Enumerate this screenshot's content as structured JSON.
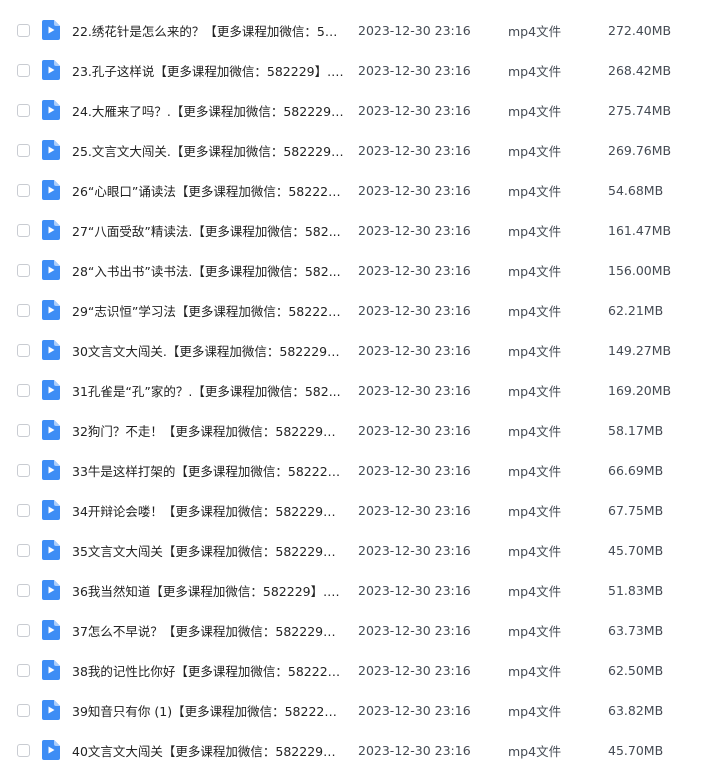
{
  "file_list": {
    "rows": [
      {
        "name": "22.绣花针是怎么来的？【更多课程加微信：582...",
        "date": "2023-12-30 23:16",
        "type": "mp4文件",
        "size": "272.40MB",
        "icon": "video-file-icon"
      },
      {
        "name": "23.孔子这样说【更多课程加微信：582229】.mp4",
        "date": "2023-12-30 23:16",
        "type": "mp4文件",
        "size": "268.42MB",
        "icon": "video-file-icon"
      },
      {
        "name": "24.大雁来了吗？.【更多课程加微信：582229】....",
        "date": "2023-12-30 23:16",
        "type": "mp4文件",
        "size": "275.74MB",
        "icon": "video-file-icon"
      },
      {
        "name": "25.文言文大闯关.【更多课程加微信：582229】....",
        "date": "2023-12-30 23:16",
        "type": "mp4文件",
        "size": "269.76MB",
        "icon": "video-file-icon"
      },
      {
        "name": "26“心眼口”诵读法【更多课程加微信：582229...",
        "date": "2023-12-30 23:16",
        "type": "mp4文件",
        "size": "54.68MB",
        "icon": "video-file-icon"
      },
      {
        "name": "27“八面受敌”精读法.【更多课程加微信：582...",
        "date": "2023-12-30 23:16",
        "type": "mp4文件",
        "size": "161.47MB",
        "icon": "video-file-icon"
      },
      {
        "name": "28“入书出书”读书法.【更多课程加微信：582...",
        "date": "2023-12-30 23:16",
        "type": "mp4文件",
        "size": "156.00MB",
        "icon": "video-file-icon"
      },
      {
        "name": "29“志识恒”学习法【更多课程加微信：582229...",
        "date": "2023-12-30 23:16",
        "type": "mp4文件",
        "size": "62.21MB",
        "icon": "video-file-icon"
      },
      {
        "name": "30文言文大闯关.【更多课程加微信：582229】....",
        "date": "2023-12-30 23:16",
        "type": "mp4文件",
        "size": "149.27MB",
        "icon": "video-file-icon"
      },
      {
        "name": "31孔雀是“孔”家的？.【更多课程加微信：582...",
        "date": "2023-12-30 23:16",
        "type": "mp4文件",
        "size": "169.20MB",
        "icon": "video-file-icon"
      },
      {
        "name": "32狗门？不走！【更多课程加微信：582229】....",
        "date": "2023-12-30 23:16",
        "type": "mp4文件",
        "size": "58.17MB",
        "icon": "video-file-icon"
      },
      {
        "name": "33牛是这样打架的【更多课程加微信：582229】...",
        "date": "2023-12-30 23:16",
        "type": "mp4文件",
        "size": "66.69MB",
        "icon": "video-file-icon"
      },
      {
        "name": "34开辩论会喽！【更多课程加微信：582229】....",
        "date": "2023-12-30 23:16",
        "type": "mp4文件",
        "size": "67.75MB",
        "icon": "video-file-icon"
      },
      {
        "name": "35文言文大闯关【更多课程加微信：582229】....",
        "date": "2023-12-30 23:16",
        "type": "mp4文件",
        "size": "45.70MB",
        "icon": "video-file-icon"
      },
      {
        "name": "36我当然知道【更多课程加微信：582229】.mp4",
        "date": "2023-12-30 23:16",
        "type": "mp4文件",
        "size": "51.83MB",
        "icon": "video-file-icon"
      },
      {
        "name": "37怎么不早说？【更多课程加微信：582229】....",
        "date": "2023-12-30 23:16",
        "type": "mp4文件",
        "size": "63.73MB",
        "icon": "video-file-icon"
      },
      {
        "name": "38我的记性比你好【更多课程加微信：582229】...",
        "date": "2023-12-30 23:16",
        "type": "mp4文件",
        "size": "62.50MB",
        "icon": "video-file-icon"
      },
      {
        "name": "39知音只有你 (1)【更多课程加微信：582229】....",
        "date": "2023-12-30 23:16",
        "type": "mp4文件",
        "size": "63.82MB",
        "icon": "video-file-icon"
      },
      {
        "name": "40文言文大闯关【更多课程加微信：582229】....",
        "date": "2023-12-30 23:16",
        "type": "mp4文件",
        "size": "45.70MB",
        "icon": "video-file-icon"
      }
    ]
  },
  "colors": {
    "icon_blue": "#3d8df5",
    "icon_blue_fold": "#a9cdfb",
    "checkbox_border": "#c9ccd2",
    "text_primary": "#222222",
    "text_secondary": "#444a53"
  }
}
